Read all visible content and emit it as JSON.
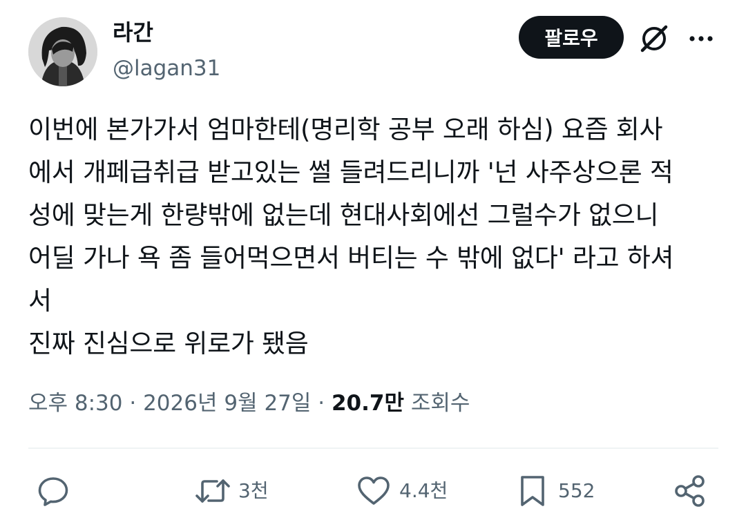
{
  "author": {
    "name": "라간",
    "handle": "@lagan31"
  },
  "header": {
    "follow_label": "팔로우"
  },
  "tweet": {
    "lines": [
      "이번에 본가가서 엄마한테(명리학 공부 오래 하심) 요즘 회사",
      "에서 개페급취급 받고있는 썰 들려드리니까 '넌 사주상으론 적",
      "성에 맞는게 한량밖에 없는데 현대사회에선 그럴수가 없으니",
      "어딜 가나 욕 좀 들어먹으면서 버티는 수 밖에 없다' 라고 하셔",
      "서",
      "진짜 진심으로 위로가 됐음"
    ]
  },
  "meta": {
    "time": "오후 8:30",
    "separator": " · ",
    "date": "2026년 9월 27일",
    "views_count": "20.7만",
    "views_label": "조회수"
  },
  "actions": {
    "reply": {
      "icon": "reply-icon",
      "count": ""
    },
    "retweet": {
      "icon": "retweet-icon",
      "count": "3천"
    },
    "like": {
      "icon": "heart-icon",
      "count": "4.4천"
    },
    "bookmark": {
      "icon": "bookmark-icon",
      "count": "552"
    },
    "share": {
      "icon": "share-icon",
      "count": ""
    }
  },
  "colors": {
    "text_primary": "#0f1419",
    "text_secondary": "#536471",
    "button_bg": "#0f1419",
    "divider": "#eff3f4"
  }
}
